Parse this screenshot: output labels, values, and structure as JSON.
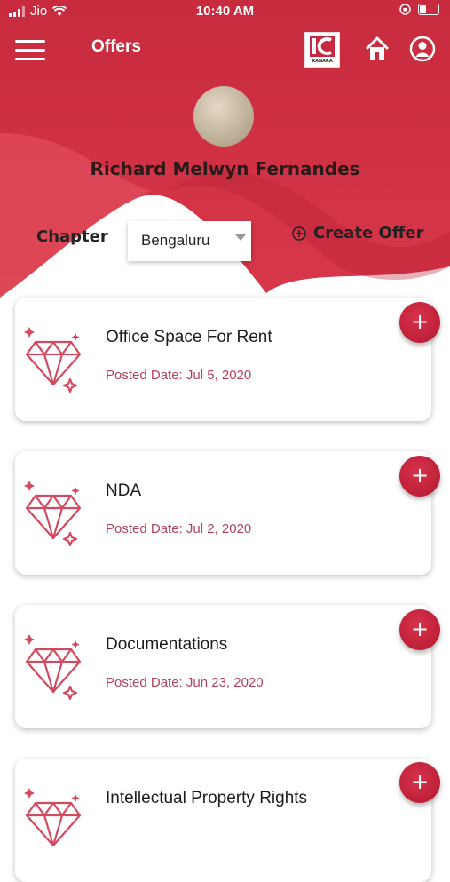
{
  "status_bar": {
    "carrier": "Jio",
    "time": "10:40 AM"
  },
  "header": {
    "title": "Offers",
    "logo_text": "KANARA"
  },
  "profile": {
    "name": "Richard Melwyn Fernandes"
  },
  "filter": {
    "chapter_label": "Chapter",
    "chapter_value": "Bengaluru",
    "create_offer_label": "Create Offer"
  },
  "offers": [
    {
      "title": "Office Space For Rent",
      "date": "Posted Date: Jul 5, 2020"
    },
    {
      "title": "NDA",
      "date": "Posted Date: Jul 2, 2020"
    },
    {
      "title": "Documentations",
      "date": "Posted Date: Jun 23, 2020"
    },
    {
      "title": "Intellectual Property Rights",
      "date": ""
    }
  ],
  "icons": {
    "menu": "menu-icon",
    "home": "home-icon",
    "profile": "user-circle-icon",
    "gem": "diamond-icon",
    "add": "plus-icon",
    "create": "plus-circle-icon"
  },
  "colors": {
    "brand": "#c8283f",
    "accent_button": "#c0203a",
    "date_text": "#b0435a"
  }
}
